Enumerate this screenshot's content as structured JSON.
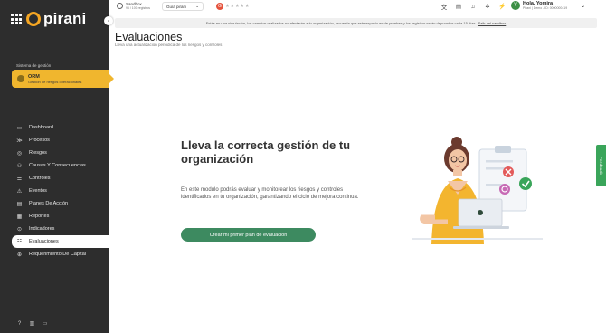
{
  "app": {
    "logo_text": "pirani",
    "brand_color": "#f5a623"
  },
  "sidebar": {
    "section_label": "Sistema de gestión",
    "module": {
      "title": "ORM",
      "subtitle": "Gestión de riesgos operacionales",
      "icon": "orm-icon"
    },
    "items": [
      {
        "label": "Dashboard",
        "icon": "monitor-icon",
        "glyph": "▭"
      },
      {
        "label": "Procesos",
        "icon": "processes-icon",
        "glyph": "≫"
      },
      {
        "label": "Riesgos",
        "icon": "risk-icon",
        "glyph": "◎"
      },
      {
        "label": "Causas Y Consecuencias",
        "icon": "cause-effect-icon",
        "glyph": "⚇"
      },
      {
        "label": "Controles",
        "icon": "controls-icon",
        "glyph": "☰"
      },
      {
        "label": "Eventos",
        "icon": "warning-icon",
        "glyph": "⚠"
      },
      {
        "label": "Planes De Acción",
        "icon": "action-plan-icon",
        "glyph": "▤"
      },
      {
        "label": "Reportes",
        "icon": "reports-icon",
        "glyph": "▦"
      },
      {
        "label": "Indicadores",
        "icon": "indicators-icon",
        "glyph": "⊙"
      },
      {
        "label": "Evaluaciones",
        "icon": "evaluations-icon",
        "glyph": "☷",
        "active": true
      },
      {
        "label": "Requerimiento De Capital",
        "icon": "capital-icon",
        "glyph": "⊕"
      }
    ],
    "bottom_icons": [
      "help-icon",
      "building-icon",
      "card-icon"
    ]
  },
  "topbar": {
    "sandbox_title": "Sandbox",
    "sandbox_sub": "96 / 100 registros",
    "guide_label": "Guía pirani",
    "rating_badge": "G",
    "stars": "★★★★★",
    "icons": [
      "translate-icon",
      "document-icon",
      "bell-icon",
      "settings-icon",
      "magic-wand-icon"
    ],
    "user_greeting": "Hola, Yomira",
    "user_sub": "Pirani | Demo - ID: 0000000419",
    "avatar_letter": "Y"
  },
  "banner": {
    "text": "Estás en una simulación, los cambios realizados no afectarán a tu organización, recuerda que este espacio es de pruebas y los registros serán depurados cada 15 días.",
    "link": "Salir del sandbox"
  },
  "page": {
    "title": "Evaluaciones",
    "subtitle": "Lleva una actualización periódica de los riesgos y controles"
  },
  "empty_state": {
    "title": "Lleva la correcta gestión de tu organización",
    "description": "En este modulo podrás evaluar y monitorear los riesgos y controles identificados en tu organización, garantizando el ciclo de mejora continua.",
    "cta_label": "Crear mi primer plan de evaluación"
  },
  "feedback_tab": {
    "label": "Feedback"
  }
}
